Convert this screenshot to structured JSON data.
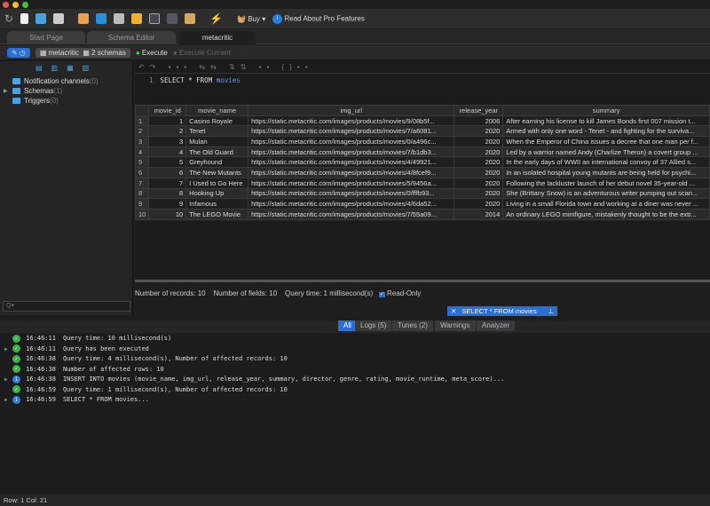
{
  "toolbar": {
    "buy": "Buy",
    "pro": "Read About Pro Features"
  },
  "tabs": [
    "Start Page",
    "Schema Editor",
    "metacritic"
  ],
  "bar2": {
    "db": "metacritic",
    "schemas": "2 schemas",
    "execute": "Execute",
    "execute_current": "Execute Current"
  },
  "sidebar": {
    "items": [
      {
        "label": "Notification channels",
        "count": "(0)"
      },
      {
        "label": "Schemas",
        "count": "(1)"
      },
      {
        "label": "Triggers",
        "count": "(0)"
      }
    ],
    "search_placeholder": "Q▾"
  },
  "editor": {
    "line": "1",
    "code_kw": "SELECT * FROM ",
    "code_ident": "movies"
  },
  "grid": {
    "columns": [
      "movie_id",
      "movie_name",
      "img_url",
      "release_year",
      "summary"
    ],
    "rows": [
      [
        "1",
        "Casino Royale",
        "https://static.metacritic.com/images/products/movies/9/08b5f...",
        "2006",
        "After earning his license to kill James Bonds first 007 mission t..."
      ],
      [
        "2",
        "Tenet",
        "https://static.metacritic.com/images/products/movies/7/a6081...",
        "2020",
        "Armed with only one word - Tenet - and fighting for the surviva..."
      ],
      [
        "3",
        "Mulan",
        "https://static.metacritic.com/images/products/movies/0/a496c...",
        "2020",
        "When the Emperor of China issues a decree that one man per f..."
      ],
      [
        "4",
        "The Old Guard",
        "https://static.metacritic.com/images/products/movies/7/b1db3...",
        "2020",
        "Led by a warrior named Andy (Charlize Theron) a covert group ..."
      ],
      [
        "5",
        "Greyhound",
        "https://static.metacritic.com/images/products/movies/4/49921...",
        "2020",
        "In the early days of WWII an international convoy of 37 Allied s..."
      ],
      [
        "6",
        "The New Mutants",
        "https://static.metacritic.com/images/products/movies/4/8fcef9...",
        "2020",
        "In an isolated hospital young mutants are being held for psychi..."
      ],
      [
        "7",
        "I Used to Go Here",
        "https://static.metacritic.com/images/products/movies/5/9456a...",
        "2020",
        "Following the lackluster launch of her debut novel 35-year-old ..."
      ],
      [
        "8",
        "Hooking Up",
        "https://static.metacritic.com/images/products/movies/0/fffb93...",
        "2020",
        "She (Brittany Snow) is an adventurous writer pumping out scan..."
      ],
      [
        "9",
        "Infamous",
        "https://static.metacritic.com/images/products/movies/4/6da52...",
        "2020",
        "Living in a small Florida town and working at a diner was never ..."
      ],
      [
        "10",
        "The LEGO Movie",
        "https://static.metacritic.com/images/products/movies/7/55a09...",
        "2014",
        "An ordinary LEGO minifigure, mistakenly thought to be the extr..."
      ]
    ]
  },
  "status": {
    "records": "Number of records: 10",
    "fields": "Number of fields: 10",
    "time": "Query time: 1 millisecond(s)",
    "readonly": "Read-Only"
  },
  "query_tab": "SELECT * FROM movies",
  "log_tabs": [
    "All",
    "Logs (5)",
    "Tunes (2)",
    "Warnings",
    "Analyzer"
  ],
  "log": [
    {
      "t": "16:46:11",
      "m": "Query time: 10 millisecond(s)",
      "type": "ok",
      "exp": false
    },
    {
      "t": "16:46:11",
      "m": "Query has been executed",
      "type": "ok",
      "exp": true
    },
    {
      "t": "16:46:38",
      "m": "Query time: 4 millisecond(s), Number of affected records: 10",
      "type": "ok",
      "exp": false
    },
    {
      "t": "16:46:38",
      "m": "Number of affected rows: 10",
      "type": "ok",
      "exp": false
    },
    {
      "t": "16:46:38",
      "m": "INSERT INTO movies (movie_name, img_url, release_year, summary, director, genre, rating, movie_runtime, meta_score)...",
      "type": "info",
      "exp": true
    },
    {
      "t": "16:46:59",
      "m": "Query time: 1 millisecond(s), Number of affected records: 10",
      "type": "ok",
      "exp": false
    },
    {
      "t": "16:46:59",
      "m": "SELECT * FROM movies...",
      "type": "info",
      "exp": true
    }
  ],
  "footer": "Row: 1  Col: 21"
}
